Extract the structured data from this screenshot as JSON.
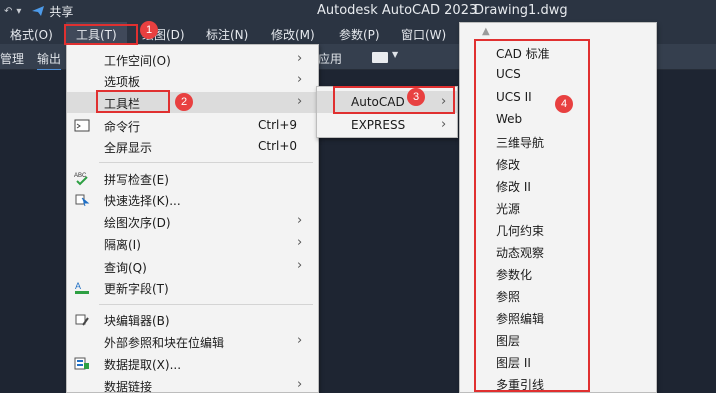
{
  "titlebar": {
    "share_label": "共享",
    "app_title": "Autodesk AutoCAD 2023",
    "doc_title": "Drawing1.dwg"
  },
  "menubar": {
    "items": [
      "格式(O)",
      "工具(T)",
      "绘图(D)",
      "标注(N)",
      "修改(M)",
      "参数(P)",
      "窗口(W)"
    ]
  },
  "ribbon": {
    "tabs": [
      "管理",
      "输出",
      "应用"
    ]
  },
  "tools_menu": {
    "items": [
      {
        "label": "工作空间(O)"
      },
      {
        "label": "选项板"
      },
      {
        "label": "工具栏"
      },
      {
        "label": "命令行",
        "shortcut": "Ctrl+9"
      },
      {
        "label": "全屏显示",
        "shortcut": "Ctrl+0"
      },
      {
        "label": "拼写检查(E)",
        "icon_text": "ABC"
      },
      {
        "label": "快速选择(K)..."
      },
      {
        "label": "绘图次序(D)"
      },
      {
        "label": "隔离(I)"
      },
      {
        "label": "查询(Q)"
      },
      {
        "label": "更新字段(T)",
        "icon_text": "A"
      },
      {
        "label": "块编辑器(B)"
      },
      {
        "label": "外部参照和块在位编辑"
      },
      {
        "label": "数据提取(X)..."
      },
      {
        "label": "数据链接"
      }
    ]
  },
  "toolbar_submenu": {
    "items": [
      "AutoCAD",
      "EXPRESS"
    ]
  },
  "autocad_toolbars": {
    "items": [
      "CAD 标准",
      "UCS",
      "UCS II",
      "Web",
      "三维导航",
      "修改",
      "修改 II",
      "光源",
      "几何约束",
      "动态观察",
      "参数化",
      "参照",
      "参照编辑",
      "图层",
      "图层 II",
      "多重引线"
    ]
  },
  "annotations": {
    "badges": [
      "1",
      "2",
      "3",
      "4"
    ],
    "color": "#e03030"
  },
  "colors": {
    "titlebar_bg": "#2b3442",
    "drawing_bg": "#1e2532",
    "menu_bg": "#f3f3f3",
    "highlight": "#dcdcdc"
  }
}
